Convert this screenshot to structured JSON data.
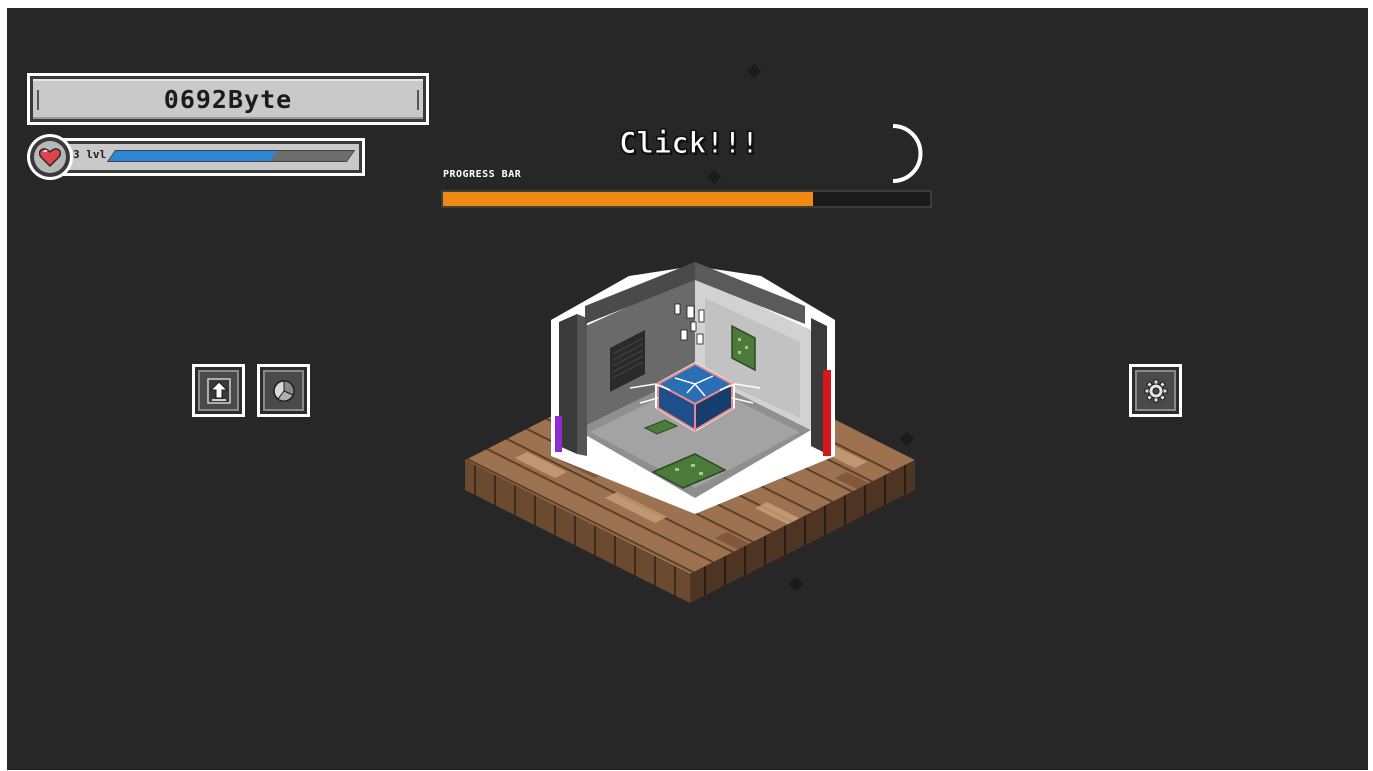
{
  "hud": {
    "bytes": "0692Byte",
    "level_text": "3 lvl",
    "level_progress": 0.68
  },
  "clicker": {
    "click_text": "Click!!!",
    "progress_label": "PROGRESS BAR",
    "progress": 0.76
  },
  "buttons": {
    "upgrade": "upgrade-arrow-icon",
    "stats": "pie-chart-icon",
    "settings": "gear-icon"
  },
  "colors": {
    "background": "#272727",
    "progress_fill": "#f08a12",
    "level_fill": "#2d86d3",
    "heart": "#e0434c"
  }
}
